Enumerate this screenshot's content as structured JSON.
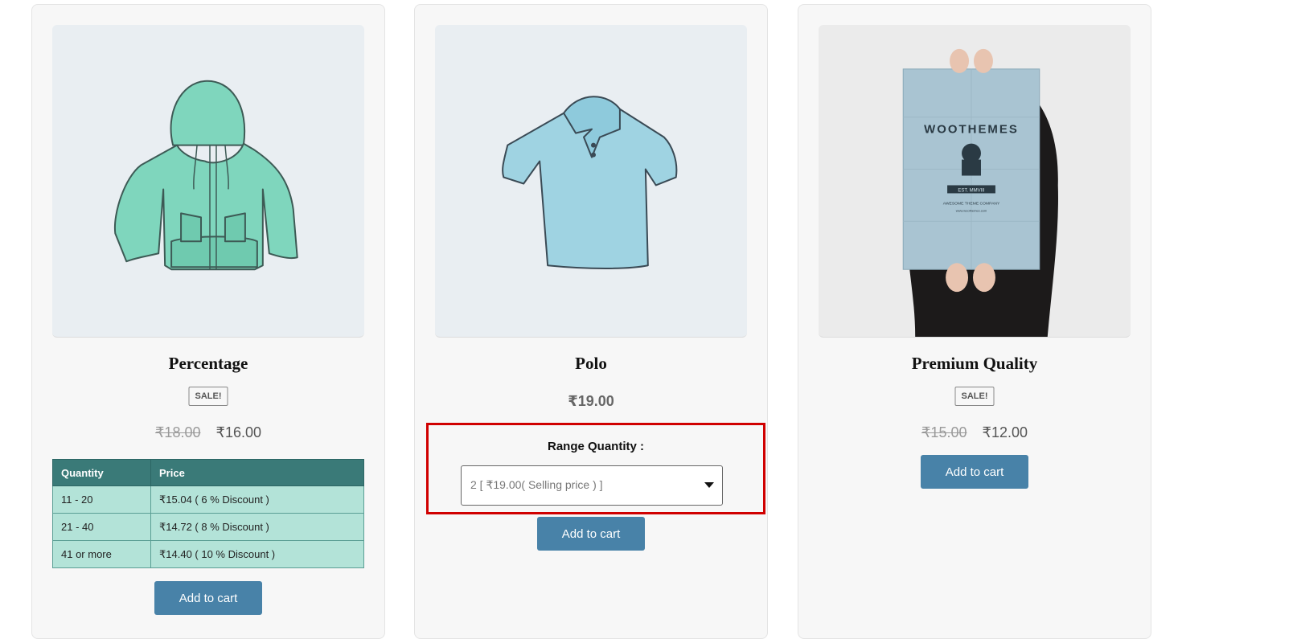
{
  "products": [
    {
      "title": "Percentage",
      "image_icon": "hoodie-image",
      "sale_badge": "SALE!",
      "old_price": "₹18.00",
      "new_price": "₹16.00",
      "discount_table": {
        "headers": [
          "Quantity",
          "Price"
        ],
        "rows": [
          [
            "11 - 20",
            "₹15.04 ( 6 % Discount )"
          ],
          [
            "21 - 40",
            "₹14.72 ( 8 % Discount )"
          ],
          [
            "41 or more",
            "₹14.40 ( 10 % Discount )"
          ]
        ]
      },
      "button_label": "Add to cart"
    },
    {
      "title": "Polo",
      "image_icon": "polo-shirt-image",
      "price": "₹19.00",
      "range_quantity": {
        "label": "Range Quantity :",
        "selected_option": "2 [ ₹19.00( Selling price ) ]"
      },
      "button_label": "Add to cart"
    },
    {
      "title": "Premium Quality",
      "image_icon": "poster-image",
      "poster_text": {
        "brand": "WOOTHEMES",
        "est": "EST. MMVIII",
        "tagline": "AWESOME THEME COMPANY",
        "url": "www.woothemes.com"
      },
      "sale_badge": "SALE!",
      "old_price": "₹15.00",
      "new_price": "₹12.00",
      "button_label": "Add to cart"
    }
  ],
  "colors": {
    "button": "#4882a8",
    "table_header": "#3a7a78",
    "table_cell": "#b3e3d8",
    "highlight_border": "#d00000"
  }
}
